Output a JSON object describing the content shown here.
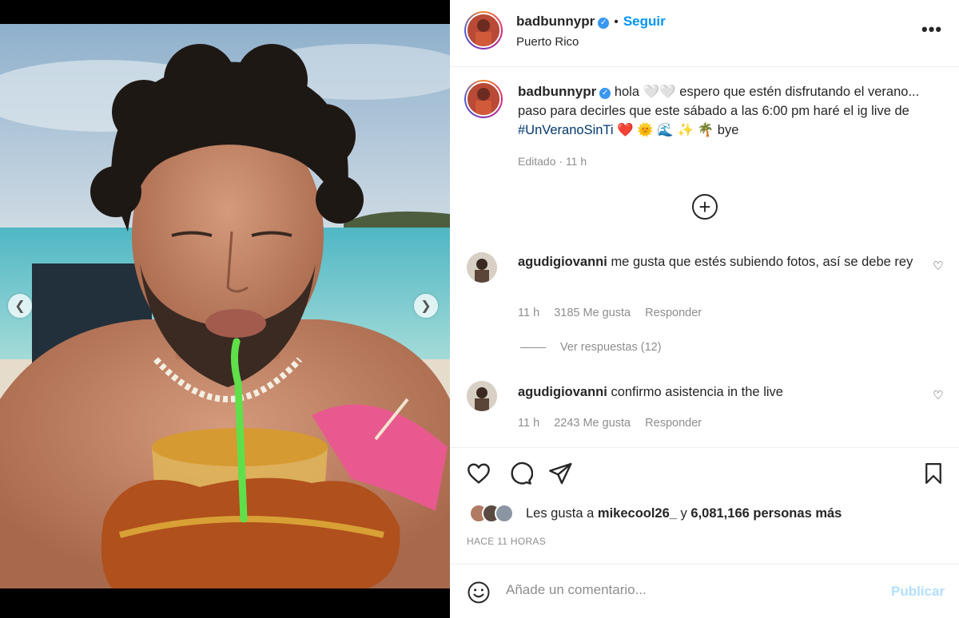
{
  "post": {
    "username": "badbunnypr",
    "follow_label": "Seguir",
    "location": "Puerto Rico",
    "more_label": "•••"
  },
  "caption": {
    "username": "badbunnypr",
    "text_part1": "hola 🤍🤍 espero que estén disfrutando el verano... paso para decirles que este sábado a las 6:00 pm haré el ig live de ",
    "hashtag": "#UnVeranoSinTi",
    "text_part2": " ❤️ 🌞 🌊 ✨ 🌴  bye",
    "edited": "Editado",
    "time": "11 h"
  },
  "comments": [
    {
      "username": "agudigiovanni",
      "text": "me gusta que estés subiendo fotos, así se debe rey",
      "time": "11 h",
      "likes": "3185 Me gusta",
      "reply_label": "Responder",
      "view_replies": "Ver respuestas (12)"
    },
    {
      "username": "agudigiovanni",
      "text": "confirmo asistencia in the live",
      "time": "11 h",
      "likes": "2243 Me gusta",
      "reply_label": "Responder"
    }
  ],
  "likes": {
    "prefix": "Les gusta a ",
    "user": "mikecool26_",
    "middle": " y ",
    "count": "6,081,166 personas más"
  },
  "timeago": "HACE 11 HORAS",
  "add_comment": {
    "placeholder": "Añade un comentario...",
    "publish_label": "Publicar"
  },
  "colors": {
    "accent": "#0095f6",
    "publish_disabled": "#b2dffc",
    "muted": "#8e8e8e"
  }
}
